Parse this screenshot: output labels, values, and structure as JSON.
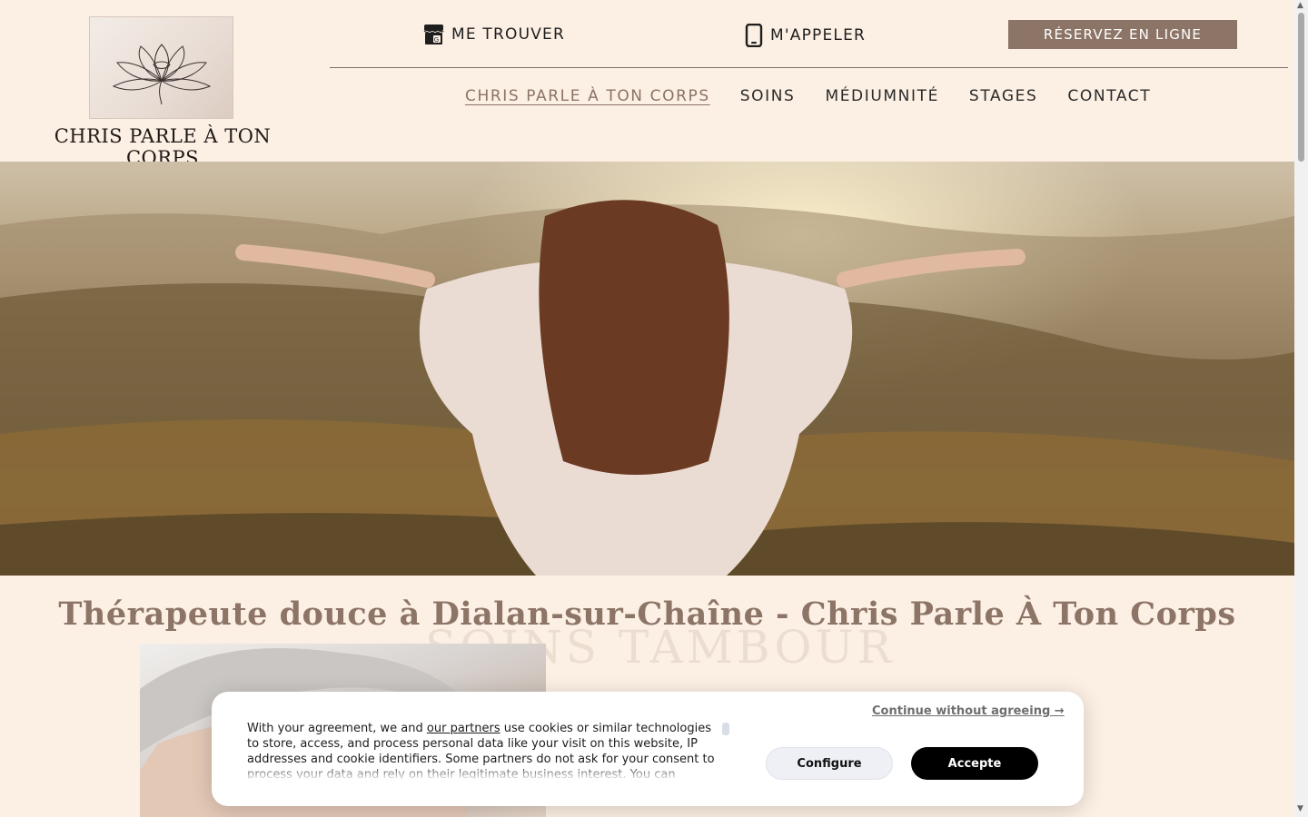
{
  "header": {
    "logo_text": "CHRIS PARLE À TON CORPS",
    "find_me": "ME TROUVER",
    "call_me": "M'APPELER",
    "book_button": "RÉSERVEZ EN LIGNE"
  },
  "nav": {
    "items": [
      {
        "label": "CHRIS PARLE À TON CORPS",
        "active": true
      },
      {
        "label": "SOINS",
        "active": false
      },
      {
        "label": "MÉDIUMNITÉ",
        "active": false
      },
      {
        "label": "STAGES",
        "active": false
      },
      {
        "label": "CONTACT",
        "active": false
      }
    ]
  },
  "main": {
    "title": "Thérapeute douce à Dialan-sur-Chaîne - Chris Parle À Ton Corps",
    "watermark": "SOINS TAMBOUR"
  },
  "cookie_banner": {
    "text_before": "With your agreement, we and ",
    "partners_link": "our partners",
    "text_after": " use cookies or similar technologies to store, access, and process personal data like your visit on this website, IP addresses and cookie identifiers. Some partners do not ask for your consent to process your data and rely on their legitimate business interest. You can",
    "continue_link": "Continue without agreeing →",
    "configure_button": "Configure",
    "accept_button": "Accepte"
  },
  "colors": {
    "background": "#fcefe3",
    "accent": "#8c7466",
    "text": "#222222"
  },
  "icons": {
    "find_me": "storefront-icon",
    "call_me": "smartphone-icon"
  }
}
